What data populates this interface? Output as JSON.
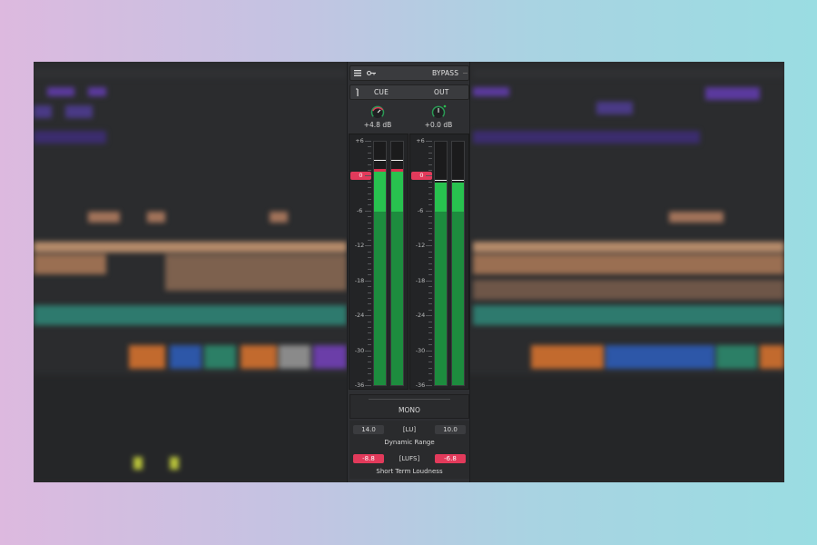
{
  "header": {
    "bypass_label": "BYPASS"
  },
  "monitor": {
    "cue_label": "CUE",
    "out_label": "OUT"
  },
  "knobs": [
    {
      "name": "cue-gain",
      "value": "+4.8 dB",
      "color": "#e23a5b"
    },
    {
      "name": "out-gain",
      "value": "+0.0 dB",
      "color": "#28c24f"
    }
  ],
  "meter": {
    "scale": [
      "+6",
      "0",
      "-6",
      "-12",
      "-18",
      "-24",
      "-30",
      "-36"
    ],
    "zero_label": "0",
    "range_db": [
      -36,
      6
    ],
    "cue_channels": [
      {
        "peak_db": 2.8,
        "level_db": 0.8,
        "rms_db": -6,
        "clip": true
      },
      {
        "peak_db": 2.8,
        "level_db": 0.8,
        "rms_db": -6,
        "clip": true
      }
    ],
    "out_channels": [
      {
        "peak_db": -0.5,
        "level_db": -1.0,
        "rms_db": -6,
        "clip": false
      },
      {
        "peak_db": -0.5,
        "level_db": -1.0,
        "rms_db": -6,
        "clip": false
      }
    ]
  },
  "mono_label": "MONO",
  "dynamic_range": {
    "left": "14.0",
    "unit": "[LU]",
    "right": "10.0",
    "label": "Dynamic Range"
  },
  "short_term": {
    "left": "-8.8",
    "unit": "[LUFS]",
    "right": "-6.8",
    "label": "Short Term Loudness"
  },
  "colors": {
    "accent_red": "#e23a5b",
    "meter_green": "#28c24f",
    "panel": "#2e2f32"
  }
}
